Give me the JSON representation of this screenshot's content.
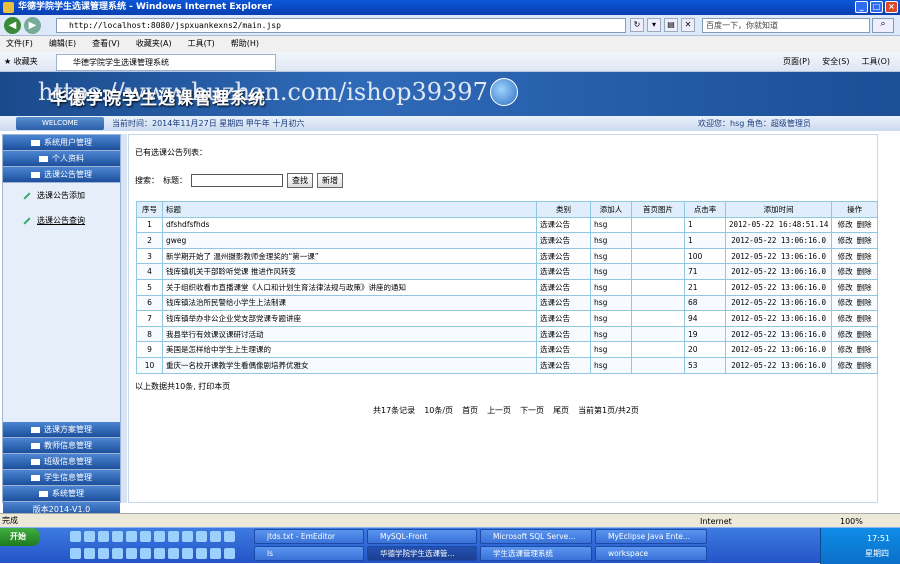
{
  "window": {
    "title": "华德学院学生选课管理系统 - Windows Internet Explorer"
  },
  "browser": {
    "address": "http://localhost:8080/jspxuankexns2/main.jsp",
    "search_placeholder": "百度一下，你就知道",
    "menu": [
      "文件(F)",
      "编辑(E)",
      "查看(V)",
      "收藏夹(A)",
      "工具(T)",
      "帮助(H)"
    ],
    "favorites": "收藏夹",
    "tab": "华德学院学生选课管理系统",
    "tools": [
      "页面(P)",
      "安全(S)",
      "工具(O)"
    ]
  },
  "banner": {
    "title": "华德学院学生选课管理系统",
    "watermark": "https://www.huzhan.com/ishop39397"
  },
  "info": {
    "welcome": "WELCOME",
    "time": "当前时间：2014年11月27日 星期四 甲午年 十月初六",
    "user": "欢迎您：hsg 角色：超级管理员"
  },
  "sidebar": {
    "top": [
      "系统用户管理",
      "个人资料",
      "选课公告管理"
    ],
    "sub": [
      "选课公告添加",
      "选课公告查询"
    ],
    "bottom": [
      "选课方案管理",
      "教师信息管理",
      "班级信息管理",
      "学生信息管理",
      "系统管理",
      "版本2014-V1.0"
    ]
  },
  "main": {
    "section_title": "已有选课公告列表：",
    "search_label": "搜索：",
    "title_label": "标题：",
    "search_btn": "查找",
    "add_btn": "新增",
    "headers": [
      "序号",
      "标题",
      "类别",
      "添加人",
      "首页图片",
      "点击率",
      "添加时间",
      "操作"
    ],
    "rows": [
      {
        "no": "1",
        "title": "dfshdfsfhds",
        "cat": "选课公告",
        "user": "hsg",
        "img": "",
        "hits": "1",
        "time": "2012-05-22 16:48:51.14"
      },
      {
        "no": "2",
        "title": "gweg",
        "cat": "选课公告",
        "user": "hsg",
        "img": "",
        "hits": "1",
        "time": "2012-05-22 13:06:16.0"
      },
      {
        "no": "3",
        "title": "新学期开始了 温州摄影教师金理奖的“第一课”",
        "cat": "选课公告",
        "user": "hsg",
        "img": "",
        "hits": "100",
        "time": "2012-05-22 13:06:16.0"
      },
      {
        "no": "4",
        "title": "钱库镇机关干部聆听党课 推进作风转变",
        "cat": "选课公告",
        "user": "hsg",
        "img": "",
        "hits": "71",
        "time": "2012-05-22 13:06:16.0"
      },
      {
        "no": "5",
        "title": "关于组织收看市直播课堂《人口和计划生育法律法规与政策》讲座的通知",
        "cat": "选课公告",
        "user": "hsg",
        "img": "",
        "hits": "21",
        "time": "2012-05-22 13:06:16.0"
      },
      {
        "no": "6",
        "title": "钱库镇法治所民警给小学生上法制课",
        "cat": "选课公告",
        "user": "hsg",
        "img": "",
        "hits": "68",
        "time": "2012-05-22 13:06:16.0"
      },
      {
        "no": "7",
        "title": "钱库镇举办非公企业党支部党课专题讲座",
        "cat": "选课公告",
        "user": "hsg",
        "img": "",
        "hits": "94",
        "time": "2012-05-22 13:06:16.0"
      },
      {
        "no": "8",
        "title": "我县举行有效课议课研讨活动",
        "cat": "选课公告",
        "user": "hsg",
        "img": "",
        "hits": "19",
        "time": "2012-05-22 13:06:16.0"
      },
      {
        "no": "9",
        "title": "美国是怎样给中学生上生理课的",
        "cat": "选课公告",
        "user": "hsg",
        "img": "",
        "hits": "20",
        "time": "2012-05-22 13:06:16.0"
      },
      {
        "no": "10",
        "title": "重庆一名校开课教学生看偶像剧培养优雅女",
        "cat": "选课公告",
        "user": "hsg",
        "img": "",
        "hits": "53",
        "time": "2012-05-22 13:06:16.0"
      }
    ],
    "op_edit": "修改",
    "op_delete": "删除",
    "footnote": "以上数据共10条, 打印本页",
    "pager": {
      "total": "共17条记录",
      "per": "10条/页",
      "first": "首页",
      "prev": "上一页",
      "next": "下一页",
      "last": "尾页",
      "current": "当前第1页/共2页"
    }
  },
  "status": {
    "left": "完成",
    "zone": "Internet",
    "zoom": "100%"
  },
  "taskbar": {
    "start": "开始",
    "items_row1": [
      "jtds.txt - EmEditor",
      "MySQL-Front",
      "Microsoft SQL Serve...",
      "MyEclipse Java Ente..."
    ],
    "items_row2": [
      "ls",
      "华德学院学生选课管...",
      "学生选课管理系统",
      "workspace"
    ],
    "clock": "17:51",
    "day": "星期四"
  }
}
